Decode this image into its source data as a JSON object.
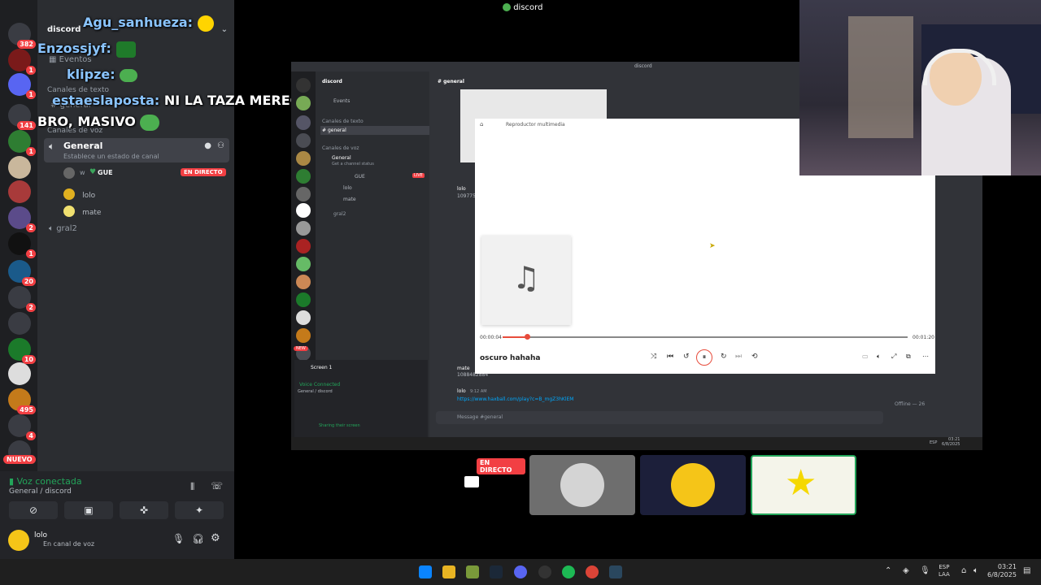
{
  "window_title": "discord",
  "rail_badges": [
    "382",
    "1",
    "1",
    "141",
    "1",
    "2",
    "1",
    "20",
    "2",
    "10",
    "495",
    "4"
  ],
  "rail_new": "NUEVO",
  "sidebar": {
    "server_name": "discord",
    "events": "Eventos",
    "text_header": "Canales de texto",
    "text_channel": "general",
    "voice_header": "Canales de voz",
    "voice_channel": "General",
    "voice_status": "Establece un estado de canal",
    "members": [
      {
        "name": "GUE",
        "prefix": "w",
        "live": "EN DIRECTO"
      },
      {
        "name": "lolo"
      },
      {
        "name": "mate"
      }
    ],
    "voice_channel_2": "gral2"
  },
  "chat_overlay": [
    {
      "user": "Agu_sanhueza:",
      "msg": ""
    },
    {
      "user": "Enzossjyf:",
      "msg": ""
    },
    {
      "user": "klipze:",
      "msg": ""
    },
    {
      "user": "estaeslaposta:",
      "msg": "NI LA TAZA MERECE ESO"
    },
    {
      "user": "",
      "msg": "BRO, MASIVO"
    }
  ],
  "voice_panel": {
    "status": "Voz conectada",
    "location": "General / discord",
    "user": "lolo",
    "user_status": "En canal de voz"
  },
  "inner": {
    "title": "discord",
    "server": "discord",
    "channel_header": "general",
    "events": "Events",
    "text_header": "Canales de texto",
    "text_channel": "general",
    "voice_header": "Canales de voz",
    "voice_channel": "General",
    "voice_status": "Get a channel status",
    "members": [
      "GUE",
      "lolo",
      "mate"
    ],
    "live": "LIVE",
    "gral2": "gral2",
    "new": "NEW",
    "screen": "Screen 1",
    "voice_connected": "Voice Connected",
    "voice_location": "General / discord",
    "sharing": "Sharing their screen",
    "msg_author_1": "lolo",
    "msg_author_2": "mate",
    "msg_text_2": "1088482884",
    "msg_author_3": "lolo",
    "msg_time_3": "9:12 AM",
    "link": "https://www.haxball.com/play?c=B_mgZ3hKlEM",
    "input_placeholder": "Message #general",
    "offline": "Offline — 26",
    "ids_prefix": "109775",
    "clock": "03:21",
    "date": "6/8/2025",
    "lang": "ESP"
  },
  "player": {
    "title": "Reproductor multimedia",
    "track": "oscuro hahaha",
    "elapsed": "00:00:04",
    "total": "00:01:20",
    "progress": 0.06
  },
  "tiles": {
    "live": "EN DIRECTO"
  },
  "taskbar": {
    "lang": "ESP",
    "layout": "LAA",
    "time": "03:21",
    "date": "6/8/2025"
  }
}
